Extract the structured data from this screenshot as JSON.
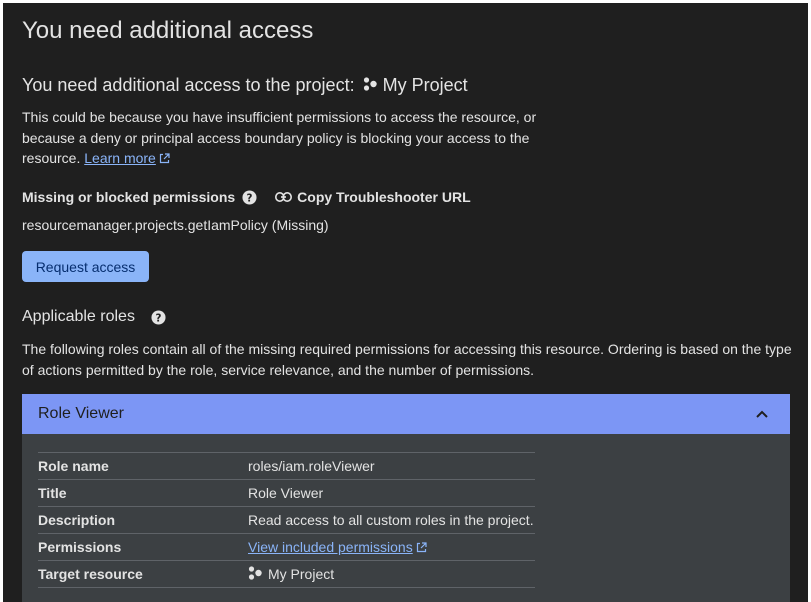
{
  "page": {
    "title": "You need additional access"
  },
  "project": {
    "heading": "You need additional access to the project:",
    "name": "My Project"
  },
  "explanation": {
    "text": "This could be because you have insufficient permissions to access the resource, or because a deny or principal access boundary policy is blocking your access to the resource.",
    "learn_more": "Learn more"
  },
  "permissions": {
    "label": "Missing or blocked permissions",
    "copy_url_label": "Copy Troubleshooter URL",
    "value": "resourcemanager.projects.getIamPolicy (Missing)"
  },
  "request_button": "Request access",
  "roles": {
    "heading": "Applicable roles",
    "description": "The following roles contain all of the missing required permissions for accessing this resource. Ordering is based on the type of actions permitted by the role, service relevance, and the number of permissions.",
    "items": [
      {
        "title": "Role Viewer",
        "expanded": true,
        "details": {
          "role_name_label": "Role name",
          "role_name": "roles/iam.roleViewer",
          "title_label": "Title",
          "title": "Role Viewer",
          "description_label": "Description",
          "description": "Read access to all custom roles in the project.",
          "permissions_label": "Permissions",
          "permissions_link": "View included permissions",
          "target_label": "Target resource",
          "target": "My Project"
        }
      }
    ]
  },
  "colors": {
    "background": "#1f1f1f",
    "text": "#e3e3e3",
    "link": "#8ab4f8",
    "button_bg": "#8ab4f8",
    "panel_header": "#7c96f5",
    "panel_body": "#3c4043"
  },
  "icons": {
    "project": "project-icon",
    "help": "help-icon",
    "link": "link-icon",
    "external": "external-link-icon",
    "chevron": "chevron-up-icon"
  }
}
